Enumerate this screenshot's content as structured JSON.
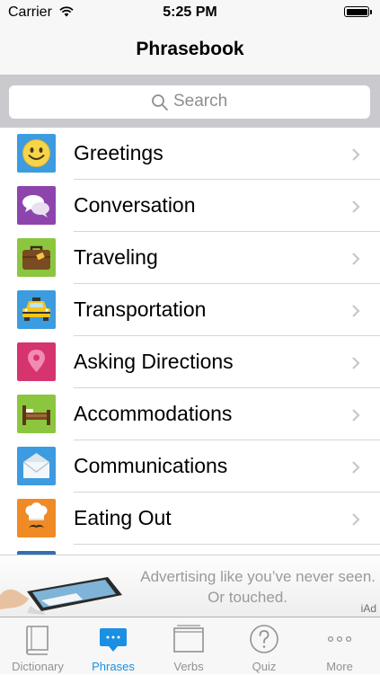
{
  "status_bar": {
    "carrier": "Carrier",
    "time": "5:25 PM"
  },
  "nav": {
    "title": "Phrasebook"
  },
  "search": {
    "placeholder": "Search"
  },
  "categories": [
    {
      "label": "Greetings",
      "icon": "smiley-icon",
      "color": "#3d9be0"
    },
    {
      "label": "Conversation",
      "icon": "speech-bubbles-icon",
      "color": "#8e44ad"
    },
    {
      "label": "Traveling",
      "icon": "suitcase-icon",
      "color": "#8cc63f"
    },
    {
      "label": "Transportation",
      "icon": "taxi-icon",
      "color": "#3d9be0"
    },
    {
      "label": "Asking Directions",
      "icon": "map-pin-icon",
      "color": "#d6346f"
    },
    {
      "label": "Accommodations",
      "icon": "bed-icon",
      "color": "#8cc63f"
    },
    {
      "label": "Communications",
      "icon": "envelope-icon",
      "color": "#3d9be0"
    },
    {
      "label": "Eating Out",
      "icon": "chef-icon",
      "color": "#f08a24"
    }
  ],
  "ad": {
    "line1": "Advertising like you’ve never seen.",
    "line2": "Or touched.",
    "badge": "iAd"
  },
  "tabs": [
    {
      "label": "Dictionary",
      "icon": "book-icon",
      "active": false
    },
    {
      "label": "Phrases",
      "icon": "phrases-bubble-icon",
      "active": true
    },
    {
      "label": "Verbs",
      "icon": "verbs-card-icon",
      "active": false
    },
    {
      "label": "Quiz",
      "icon": "question-circle-icon",
      "active": false
    },
    {
      "label": "More",
      "icon": "more-dots-icon",
      "active": false
    }
  ],
  "colors": {
    "accent": "#1a8fe3",
    "tab_inactive": "#929292"
  }
}
